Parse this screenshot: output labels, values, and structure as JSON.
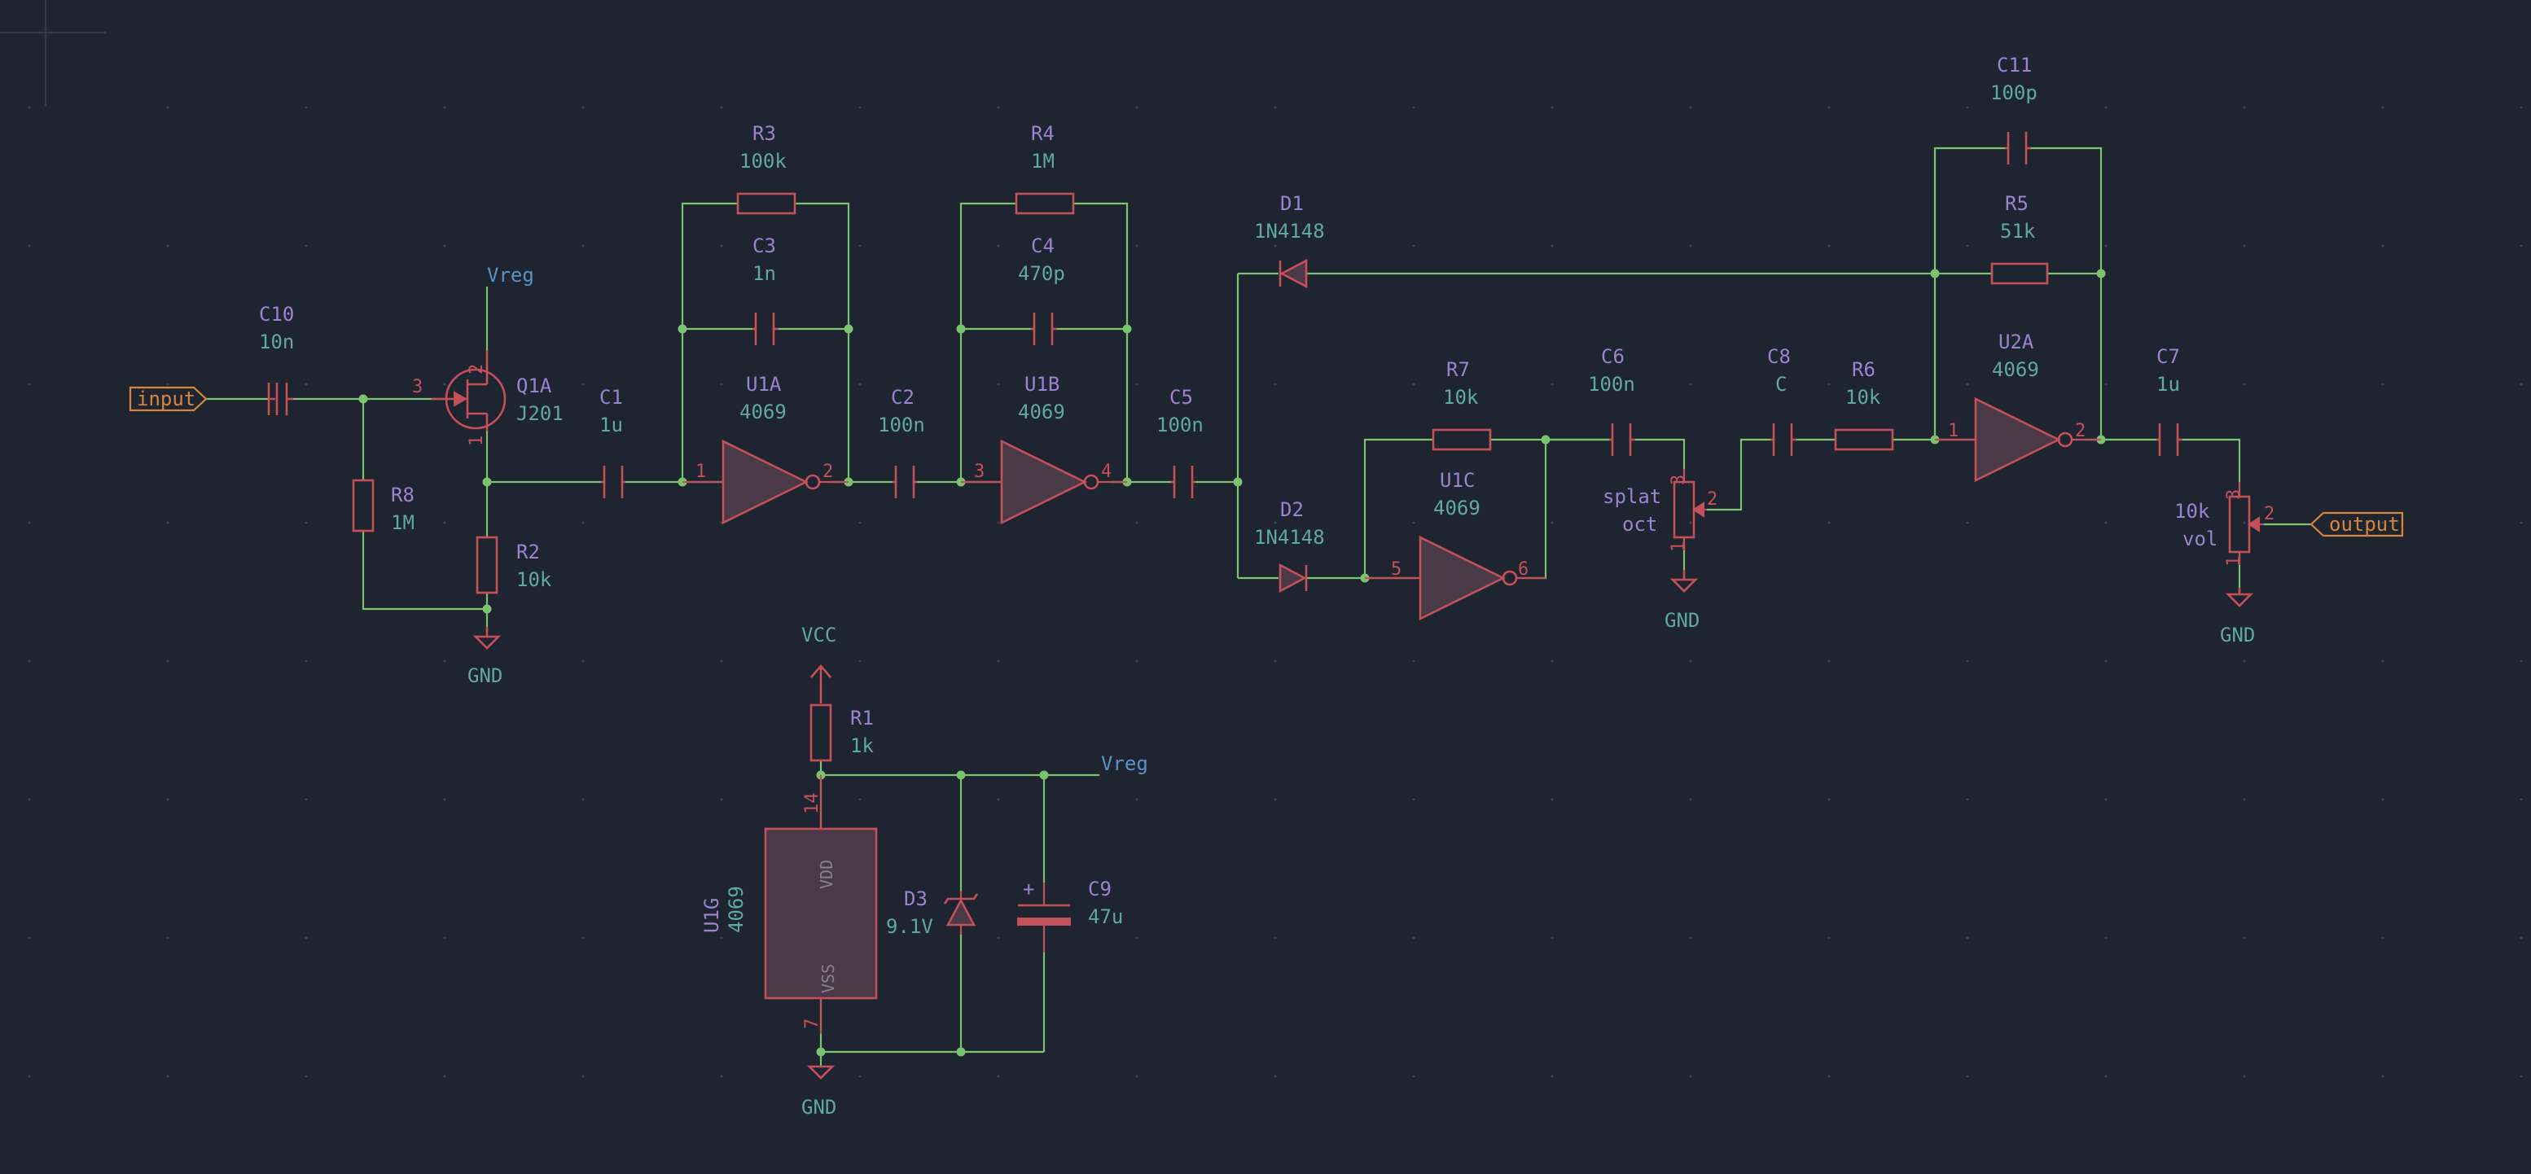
{
  "components": {
    "C10": {
      "ref": "C10",
      "value": "10n"
    },
    "Q1A": {
      "ref": "Q1A",
      "value": "J201"
    },
    "R8": {
      "ref": "R8",
      "value": "1M"
    },
    "R2": {
      "ref": "R2",
      "value": "10k"
    },
    "C1": {
      "ref": "C1",
      "value": "1u"
    },
    "R3": {
      "ref": "R3",
      "value": "100k"
    },
    "C3": {
      "ref": "C3",
      "value": "1n"
    },
    "U1A": {
      "ref": "U1A",
      "value": "4069"
    },
    "C2": {
      "ref": "C2",
      "value": "100n"
    },
    "R4": {
      "ref": "R4",
      "value": "1M"
    },
    "C4": {
      "ref": "C4",
      "value": "470p"
    },
    "U1B": {
      "ref": "U1B",
      "value": "4069"
    },
    "C5": {
      "ref": "C5",
      "value": "100n"
    },
    "D1": {
      "ref": "D1",
      "value": "1N4148"
    },
    "D2": {
      "ref": "D2",
      "value": "1N4148"
    },
    "R7": {
      "ref": "R7",
      "value": "10k"
    },
    "U1C": {
      "ref": "U1C",
      "value": "4069"
    },
    "C6": {
      "ref": "C6",
      "value": "100n"
    },
    "RV_splat": {
      "ref": "splat",
      "value": "oct"
    },
    "C8": {
      "ref": "C8",
      "value": "C"
    },
    "R6": {
      "ref": "R6",
      "value": "10k"
    },
    "C11": {
      "ref": "C11",
      "value": "100p"
    },
    "R5": {
      "ref": "R5",
      "value": "51k"
    },
    "U2A": {
      "ref": "U2A",
      "value": "4069"
    },
    "C7": {
      "ref": "C7",
      "value": "1u"
    },
    "RV_vol": {
      "ref": "10k",
      "value": "vol"
    },
    "R1": {
      "ref": "R1",
      "value": "1k"
    },
    "U1G": {
      "ref": "U1G",
      "value": "4069",
      "pin_top_name": "VDD",
      "pin_bottom_name": "VSS"
    },
    "D3": {
      "ref": "D3",
      "value": "9.1V"
    },
    "C9": {
      "ref": "C9",
      "value": "47u",
      "polarity": "+"
    }
  },
  "pins": {
    "q1_gate": "3",
    "q1_drain": "2",
    "q1_source": "1",
    "u1a_in": "1",
    "u1a_out": "2",
    "u1b_in": "3",
    "u1b_out": "4",
    "u1c_in": "5",
    "u1c_out": "6",
    "u2a_in": "1",
    "u2a_out": "2",
    "rv1_top": "3",
    "rv1_wiper": "2",
    "rv1_bot": "1",
    "rv2_top": "3",
    "rv2_wiper": "2",
    "rv2_bot": "1",
    "u1g_vdd": "14",
    "u1g_vss": "7"
  },
  "nets": {
    "vreg": "Vreg",
    "vreg2": "Vreg",
    "vcc": "VCC",
    "gnd": "GND"
  },
  "ports": {
    "input": "input",
    "output": "output"
  },
  "colors": {
    "background": "#1e2430",
    "wire": "#7bc46f",
    "symbol": "#c4505a",
    "reference": "#9c82cf",
    "value": "#5fa8a4",
    "net_label": "#5a92c8",
    "port": "#d8843a"
  }
}
